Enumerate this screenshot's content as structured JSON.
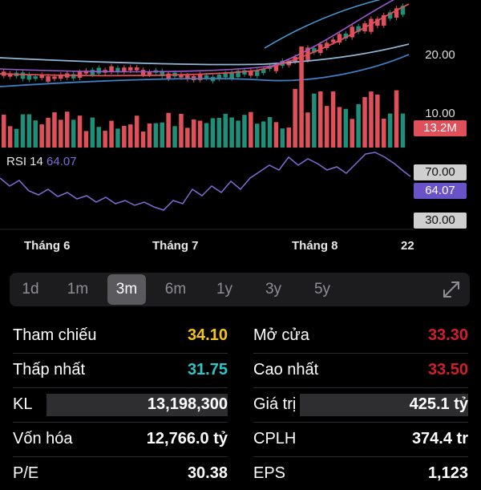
{
  "chart": {
    "price_ticks": [
      "20.00",
      "10.00"
    ],
    "volume_tag": "13.2M",
    "rsi_label": "RSI 14",
    "rsi_value": "64.07",
    "rsi_levels": [
      "70.00",
      "30.00"
    ],
    "months": [
      "Tháng 6",
      "Tháng 7",
      "Tháng 8",
      "22"
    ]
  },
  "ranges": [
    "1d",
    "1m",
    "3m",
    "6m",
    "1y",
    "3y",
    "5y"
  ],
  "selected_range": "3m",
  "stats": {
    "reference": {
      "label": "Tham chiếu",
      "value": "34.10"
    },
    "open": {
      "label": "Mở cửa",
      "value": "33.30"
    },
    "low": {
      "label": "Thấp nhất",
      "value": "31.75"
    },
    "high": {
      "label": "Cao nhất",
      "value": "33.50"
    },
    "volume": {
      "label": "KL",
      "value": "13,198,300"
    },
    "turnover": {
      "label": "Giá trị",
      "value": "425.1 tỷ"
    },
    "market_cap": {
      "label": "Vốn hóa",
      "value": "12,766.0 tỷ"
    },
    "shares": {
      "label": "CPLH",
      "value": "374.4 tr"
    },
    "pe": {
      "label": "P/E",
      "value": "30.38"
    },
    "eps": {
      "label": "EPS",
      "value": "1,123"
    }
  },
  "colors": {
    "up": "#1f8f7a",
    "down": "#e0505a",
    "rsi": "#7b6fd6",
    "reference": "#f5c518",
    "low": "#2ec7c9",
    "high": "#d0202a"
  }
}
